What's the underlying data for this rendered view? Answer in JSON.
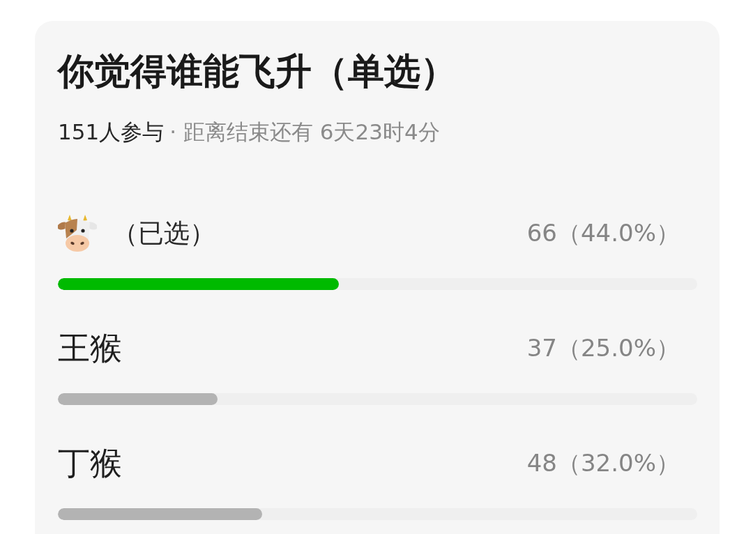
{
  "poll": {
    "title": "你觉得谁能飞升（单选）",
    "participants": "151人参与",
    "deadline": "· 距离结束还有 6天23时4分",
    "options": [
      {
        "kind": "icon",
        "note": "（已选）",
        "selected": true,
        "count": "66（44.0%）",
        "level": 0.44
      },
      {
        "kind": "text",
        "label": "王猴",
        "selected": false,
        "count": "37（25.0%）",
        "level": 0.25
      },
      {
        "kind": "text",
        "label": "丁猴",
        "selected": false,
        "count": "48（32.0%）",
        "level": 0.32
      }
    ]
  }
}
